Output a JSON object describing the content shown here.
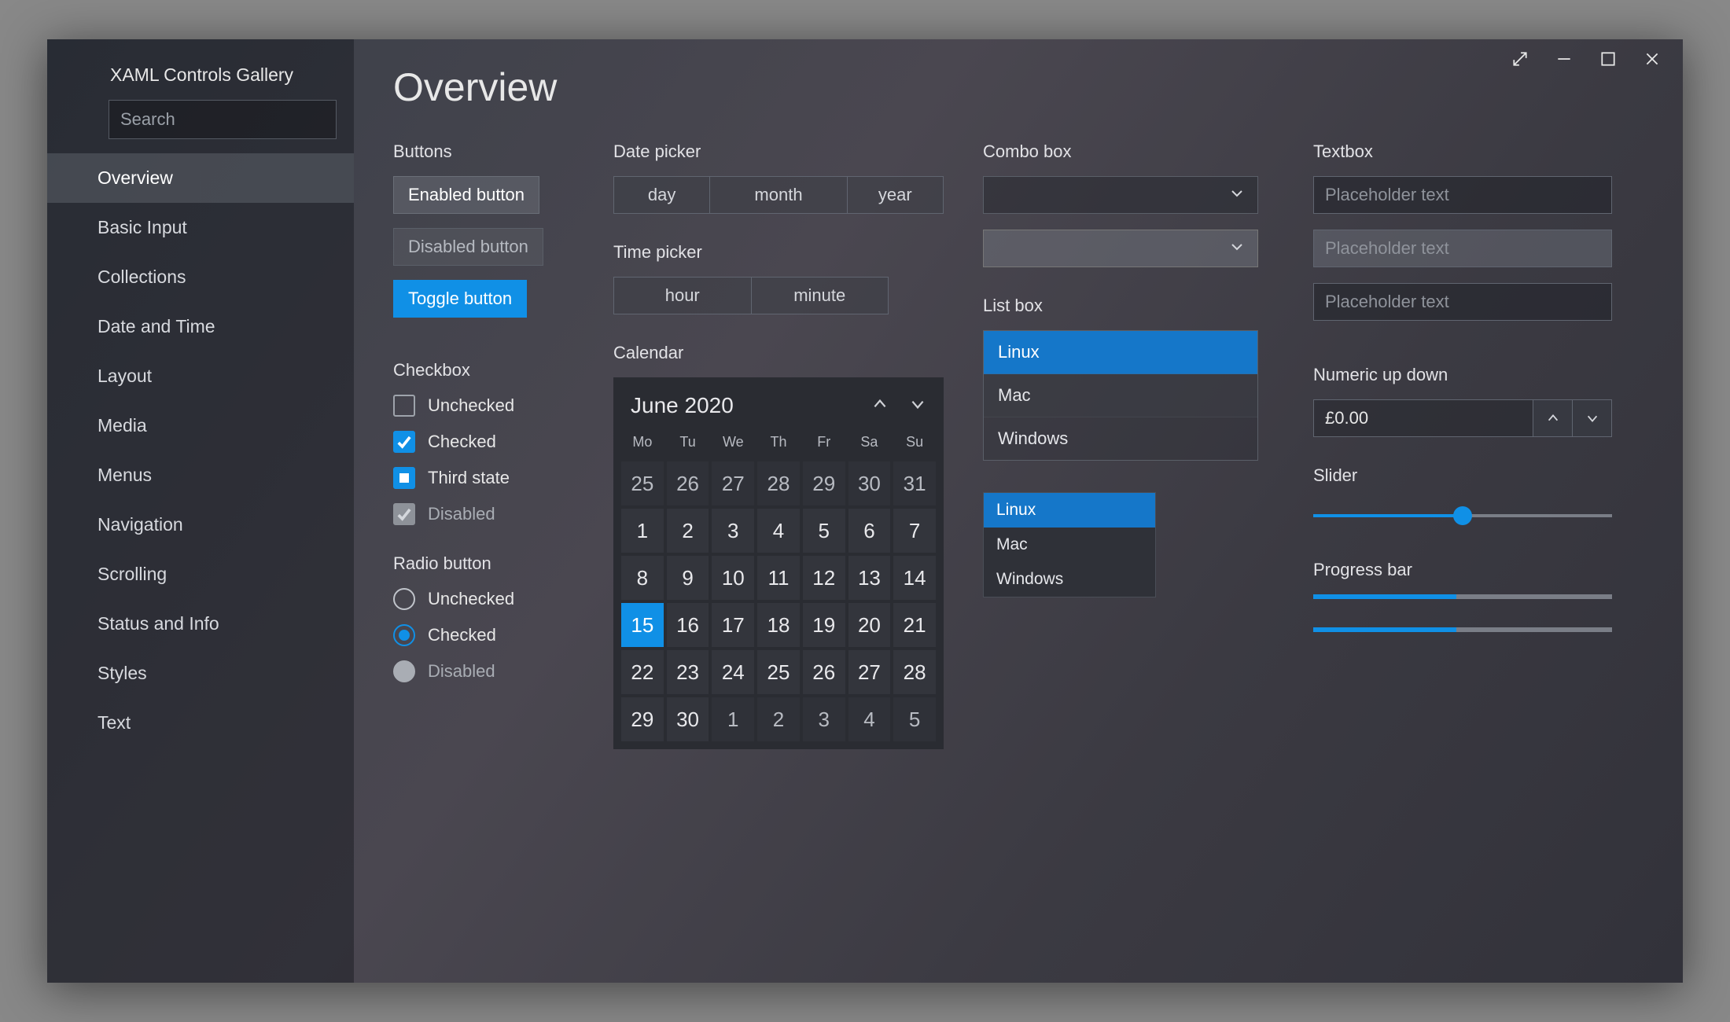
{
  "app_title": "XAML Controls Gallery",
  "search_placeholder": "Search",
  "page_title": "Overview",
  "sidebar_items": [
    "Overview",
    "Basic Input",
    "Collections",
    "Date and Time",
    "Layout",
    "Media",
    "Menus",
    "Navigation",
    "Scrolling",
    "Status and Info",
    "Styles",
    "Text"
  ],
  "sidebar_active": 0,
  "buttons": {
    "label": "Buttons",
    "enabled": "Enabled button",
    "disabled": "Disabled button",
    "toggle": "Toggle button"
  },
  "checkbox": {
    "label": "Checkbox",
    "unchecked": "Unchecked",
    "checked": "Checked",
    "third": "Third state",
    "disabled": "Disabled"
  },
  "radio": {
    "label": "Radio button",
    "unchecked": "Unchecked",
    "checked": "Checked",
    "disabled": "Disabled"
  },
  "datepicker": {
    "label": "Date picker",
    "day": "day",
    "month": "month",
    "year": "year"
  },
  "timepicker": {
    "label": "Time picker",
    "hour": "hour",
    "minute": "minute"
  },
  "calendar": {
    "label": "Calendar",
    "title": "June 2020",
    "dow": [
      "Mo",
      "Tu",
      "We",
      "Th",
      "Fr",
      "Sa",
      "Su"
    ],
    "selected": 15,
    "leading_out": [
      25,
      26,
      27,
      28,
      29,
      30,
      31
    ],
    "days": [
      1,
      2,
      3,
      4,
      5,
      6,
      7,
      8,
      9,
      10,
      11,
      12,
      13,
      14,
      15,
      16,
      17,
      18,
      19,
      20,
      21,
      22,
      23,
      24,
      25,
      26,
      27,
      28
    ],
    "trailing_out_start_index": 2,
    "last_row": [
      29,
      30,
      1,
      2,
      3,
      4,
      5
    ]
  },
  "combobox": {
    "label": "Combo box"
  },
  "listbox": {
    "label": "List box",
    "items": [
      "Linux",
      "Mac",
      "Windows"
    ],
    "selected": 0
  },
  "textbox": {
    "label": "Textbox",
    "placeholder": "Placeholder text"
  },
  "numeric": {
    "label": "Numeric up down",
    "value": "£0.00"
  },
  "slider": {
    "label": "Slider",
    "value_pct": 50
  },
  "progress": {
    "label": "Progress bar",
    "values_pct": [
      48,
      48
    ]
  }
}
